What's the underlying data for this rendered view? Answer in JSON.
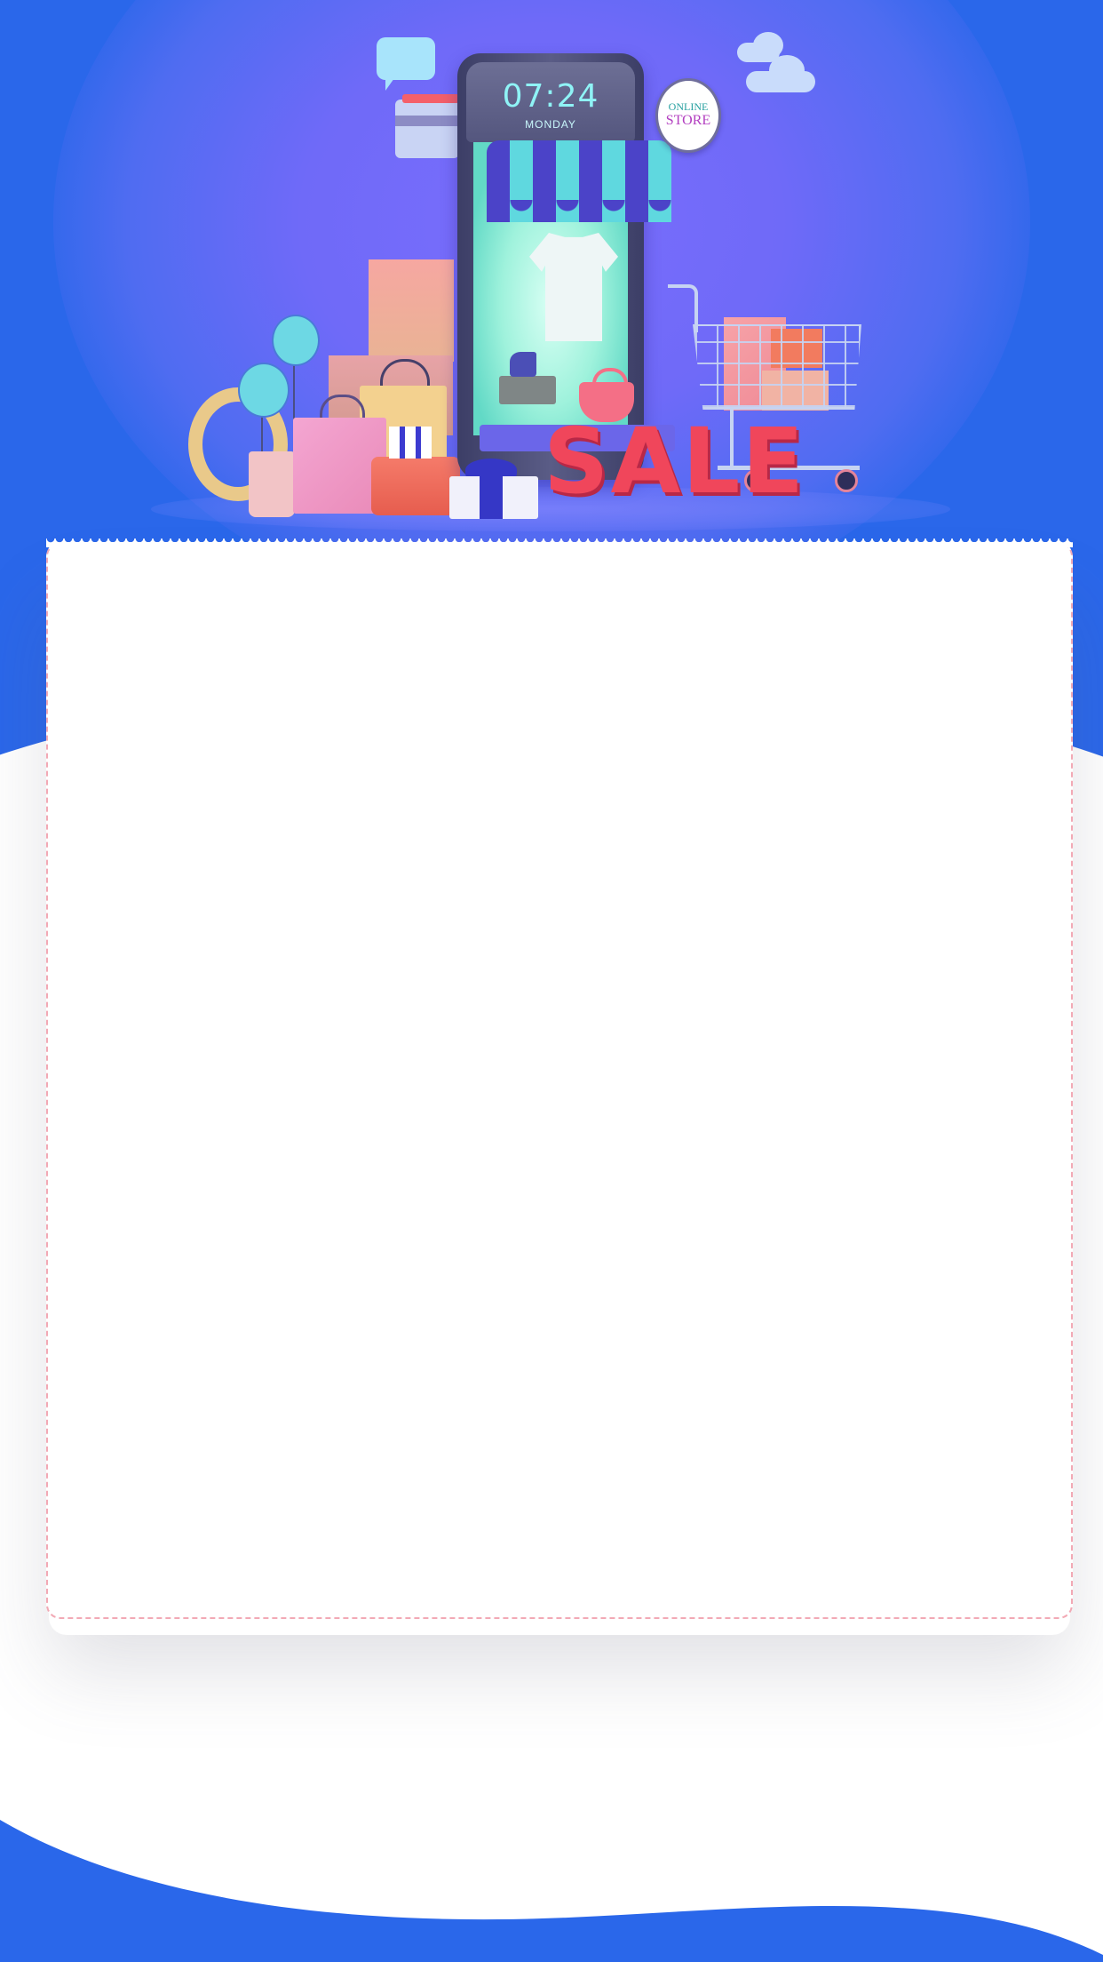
{
  "hero": {
    "phone_time": "07:24",
    "phone_day": "MONDAY",
    "store_sign_line1": "ONLINE",
    "store_sign_line2": "STORE",
    "sale_text": "SALE"
  },
  "colors": {
    "background_blue": "#2a67ea",
    "hero_purple": "#7a6dfc",
    "sale_red": "#f0465b",
    "ticket_border": "#f2a9b5",
    "card_background": "#ffffff"
  }
}
